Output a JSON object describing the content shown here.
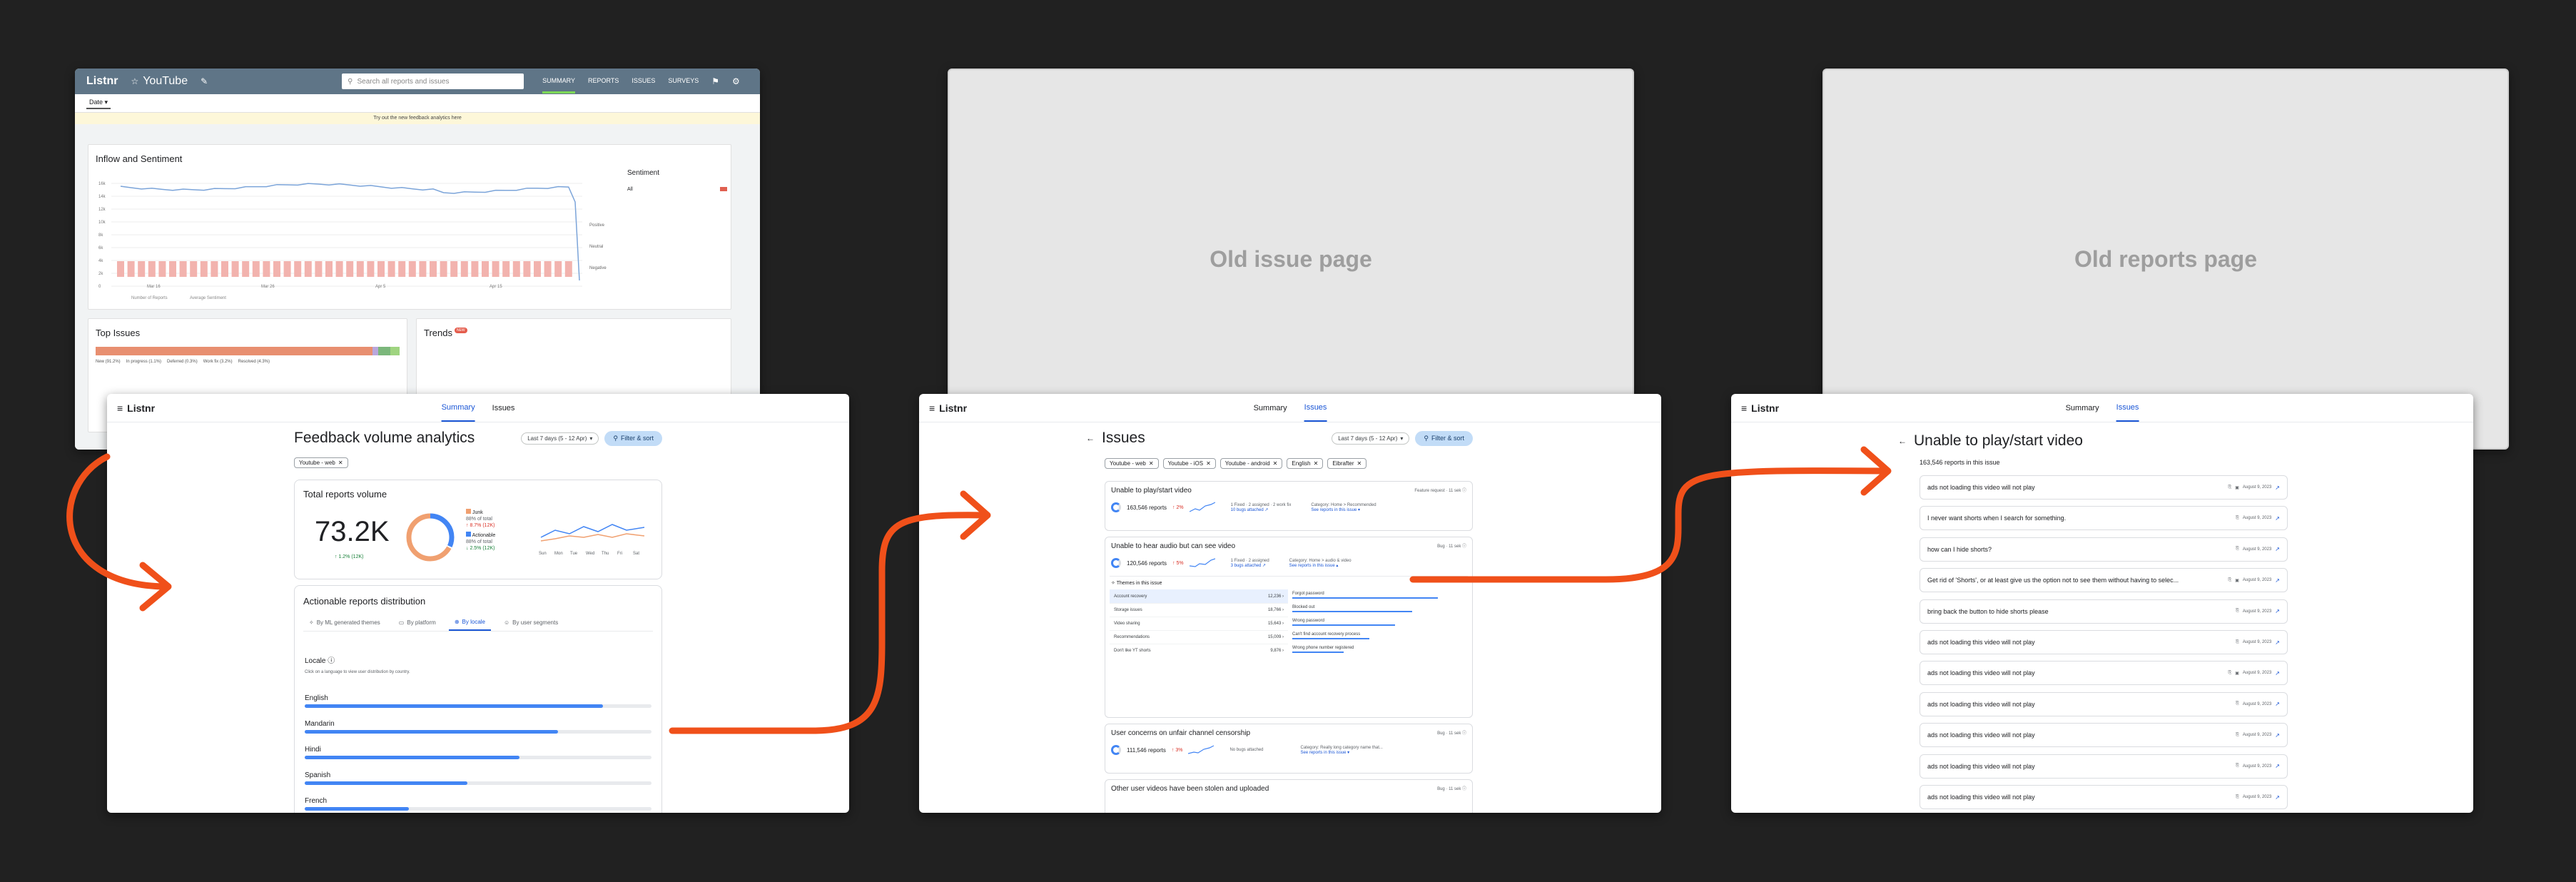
{
  "labels": {
    "old_issue_page": "Old issue page",
    "old_reports_page": "Old reports page"
  },
  "colors": {
    "background": "#212121",
    "arrow": "#f0501a",
    "accent_blue": "#1a56d6",
    "bar_blue": "#4285f4",
    "old_header": "#5f7587"
  },
  "old_dashboard": {
    "app_name": "Listnr",
    "project": "YouTube",
    "search_placeholder": "Search all reports and issues",
    "nav": [
      "SUMMARY",
      "REPORTS",
      "ISSUES",
      "SURVEYS"
    ],
    "filter": "Date",
    "banner": "Try out the new feedback analytics here",
    "inflow_title": "Inflow and Sentiment",
    "sentiment_title": "Sentiment",
    "sentiment_value": "All",
    "y_ticks": [
      "16k",
      "14k",
      "12k",
      "10k",
      "8k",
      "6k",
      "4k",
      "2k",
      "0"
    ],
    "x_ticks": [
      "Mar 16",
      "Mar 26",
      "Apr 5",
      "Apr 15"
    ],
    "sentiment_axis": [
      "Positive",
      "Neutral",
      "Negative"
    ],
    "legend": [
      "Number of Reports",
      "Average Sentiment"
    ],
    "top_issues_title": "Top Issues",
    "top_issues_legend": [
      "New (91.2%)",
      "In progress (1.1%)",
      "Deferred (0.3%)",
      "Work fix (3.2%)",
      "Resolved (4.3%)"
    ],
    "trends_title": "Trends",
    "trends_badge": "NEW"
  },
  "summary_page": {
    "app_name": "Listnr",
    "tabs": [
      "Summary",
      "Issues"
    ],
    "title": "Feedback volume analytics",
    "date_range": "Last 7 days (5 - 12 Apr)",
    "filter_button": "Filter & sort",
    "chip": "Youtube - web",
    "total_card": {
      "title": "Total reports volume",
      "value": "73.2K",
      "delta": "1.2% (12K)",
      "junk_label": "Junk",
      "junk_pct": "88% of total",
      "junk_delta": "8.7% (12K)",
      "actionable_label": "Actionable",
      "actionable_pct": "88% of total",
      "actionable_delta": "2.5% (12K)",
      "days": [
        "Sun",
        "Mon",
        "Tue",
        "Wed",
        "Thu",
        "Fri",
        "Sat"
      ]
    },
    "dist_card": {
      "title": "Actionable reports distribution",
      "tabs": [
        "By ML generated themes",
        "By platform",
        "By locale",
        "By user segments"
      ],
      "locale_label": "Locale",
      "hint": "Click on a language to view user distribution by country.",
      "locales": [
        {
          "name": "English",
          "value": 0.86
        },
        {
          "name": "Mandarin",
          "value": 0.73
        },
        {
          "name": "Hindi",
          "value": 0.62
        },
        {
          "name": "Spanish",
          "value": 0.47
        },
        {
          "name": "French",
          "value": 0.3
        }
      ]
    }
  },
  "issues_page": {
    "app_name": "Listnr",
    "tabs": [
      "Summary",
      "Issues"
    ],
    "title": "Issues",
    "date_range": "Last 7 days (5 - 12 Apr)",
    "filter_button": "Filter & sort",
    "chips": [
      "Youtube - web",
      "Youtube - iOS",
      "Youtube - android",
      "English",
      "Eibrafter"
    ],
    "issue1": {
      "title": "Unable to play/start video",
      "type": "Feature request",
      "age": "11 sek",
      "reports": "163,546 reports",
      "delta": "2%",
      "meta": "1 Fixed · 2 assigned · 2 work fix",
      "bugs": "10 bugs attached",
      "category": "Category: Home > Recommended",
      "see": "See reports in this issue"
    },
    "issue2": {
      "title": "Unable to hear audio but can see video",
      "type": "Bug",
      "age": "11 sek",
      "reports": "120,546 reports",
      "delta": "5%",
      "meta": "1 Fixed · 2 assigned",
      "bugs": "3 bugs attached",
      "category": "Category: Home > audio & video",
      "see": "See reports in this issue",
      "themes_label": "Themes in this issue",
      "themes": [
        {
          "name": "Account recovery",
          "count": "12,236"
        },
        {
          "name": "Storage issues",
          "count": "18,766"
        },
        {
          "name": "Video sharing",
          "count": "15,643"
        },
        {
          "name": "Recommendations",
          "count": "15,009"
        },
        {
          "name": "Don't like YT shorts",
          "count": "9,876"
        }
      ],
      "subthemes": [
        {
          "name": "Forgot password",
          "value": 0.85
        },
        {
          "name": "Blocked out",
          "value": 0.7
        },
        {
          "name": "Wrong password",
          "value": 0.6
        },
        {
          "name": "Can't find account recovery process",
          "value": 0.45
        },
        {
          "name": "Wrong phone number registered",
          "value": 0.3
        }
      ]
    },
    "issue3": {
      "title": "User concerns on unfair channel censorship",
      "type": "Bug",
      "age": "11 sek",
      "reports": "111,546 reports",
      "delta": "3%",
      "bugs": "No bugs attached",
      "category": "Category: Really long category name that...",
      "see": "See reports in this issue"
    },
    "issue4": {
      "title": "Other user videos have been stolen and uploaded",
      "type": "Bug",
      "age": "11 sek"
    }
  },
  "reports_page": {
    "app_name": "Listnr",
    "tabs": [
      "Summary",
      "Issues"
    ],
    "title": "Unable to play/start video",
    "count": "163,546 reports in this issue",
    "date": "August 9, 2023",
    "reports": [
      "ads not loading this video will not play",
      "I never want shorts when I search for something.",
      "how can I hide shorts?",
      "Get rid of 'Shorts', or at least give us the option not to see them without having to selec...",
      "bring back the button to hide shorts please",
      "ads not loading this video will not play",
      "ads not loading this video will not play",
      "ads not loading this video will not play",
      "ads not loading this video will not play",
      "ads not loading this video will not play",
      "ads not loading this video will not play"
    ]
  }
}
